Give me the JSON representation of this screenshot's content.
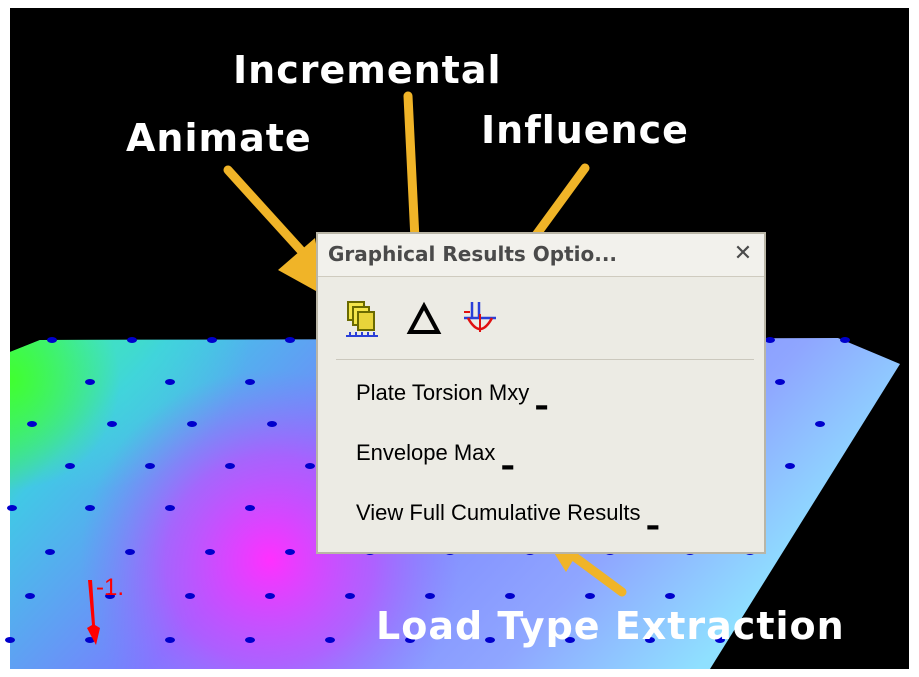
{
  "callouts": {
    "incremental": "Incremental",
    "animate": "Animate",
    "influence": "Influence",
    "load_type_extraction": "Load Type Extraction"
  },
  "panel": {
    "title": "Graphical Results Optio...",
    "close_glyph": "✕",
    "tools": [
      {
        "name": "animate",
        "icon": "animate-frames-icon"
      },
      {
        "name": "incremental",
        "icon": "delta-triangle-icon"
      },
      {
        "name": "influence",
        "icon": "influence-line-icon"
      }
    ],
    "menu": [
      {
        "label": "Plate Torsion Mxy",
        "has_dropdown": true
      },
      {
        "label": "Envelope Max",
        "has_dropdown": true
      },
      {
        "label": "View Full Cumulative Results",
        "has_dropdown": true
      }
    ]
  },
  "model": {
    "scale_label": "-1."
  },
  "colors": {
    "background": "#000000",
    "arrow": "#f0b428",
    "callout_text": "#ffffff",
    "node_dots": "#0000cc",
    "scale_label": "#ff0000",
    "panel_bg": "#ecebe4"
  }
}
